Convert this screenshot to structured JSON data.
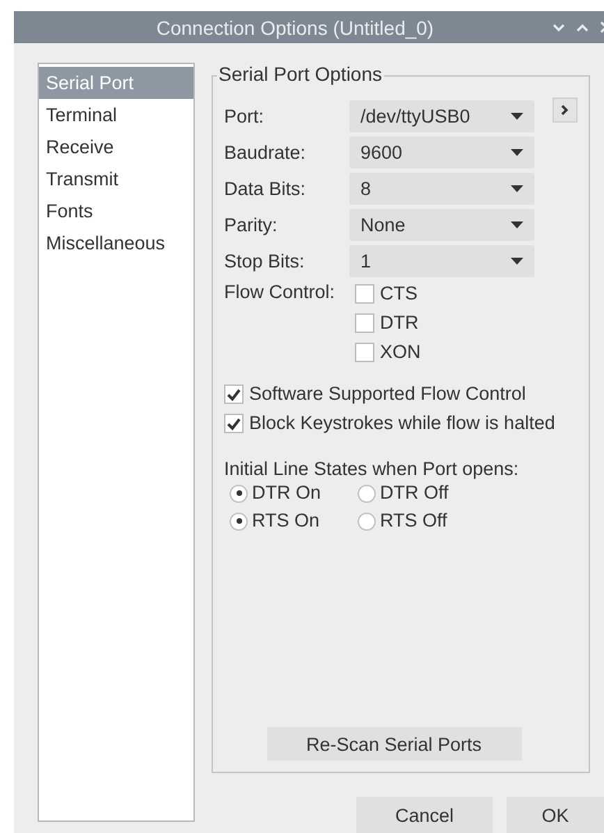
{
  "window": {
    "title": "Connection Options (Untitled_0)"
  },
  "sidebar": {
    "items": [
      {
        "label": "Serial Port",
        "selected": true
      },
      {
        "label": "Terminal",
        "selected": false
      },
      {
        "label": "Receive",
        "selected": false
      },
      {
        "label": "Transmit",
        "selected": false
      },
      {
        "label": "Fonts",
        "selected": false
      },
      {
        "label": "Miscellaneous",
        "selected": false
      }
    ]
  },
  "group": {
    "title": "Serial Port Options",
    "fields": [
      {
        "label": "Port:",
        "value": "/dev/ttyUSB0"
      },
      {
        "label": "Baudrate:",
        "value": "9600"
      },
      {
        "label": "Data Bits:",
        "value": "8"
      },
      {
        "label": "Parity:",
        "value": "None"
      },
      {
        "label": "Stop Bits:",
        "value": "1"
      }
    ],
    "flow_control": {
      "label": "Flow Control:",
      "options": [
        {
          "label": "CTS",
          "checked": false
        },
        {
          "label": "DTR",
          "checked": false
        },
        {
          "label": "XON",
          "checked": false
        }
      ]
    },
    "options": [
      {
        "label": "Software Supported Flow Control",
        "checked": true
      },
      {
        "label": "Block Keystrokes while flow is halted",
        "checked": true
      }
    ],
    "line_states": {
      "label": "Initial Line States when Port opens:",
      "rows": [
        [
          {
            "label": "DTR On",
            "selected": true
          },
          {
            "label": "DTR Off",
            "selected": false
          }
        ],
        [
          {
            "label": "RTS On",
            "selected": true
          },
          {
            "label": "RTS Off",
            "selected": false
          }
        ]
      ]
    },
    "rescan_button": "Re-Scan Serial Ports"
  },
  "buttons": [
    "Cancel",
    "OK"
  ]
}
